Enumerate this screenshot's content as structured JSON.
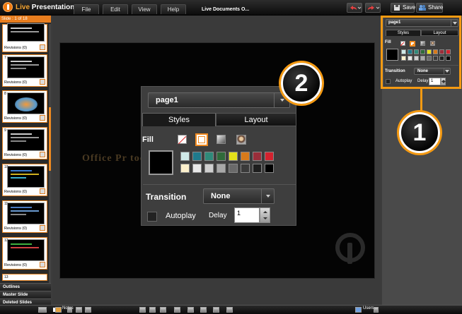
{
  "app": {
    "title_live": "Live",
    "title_rest": "Presentations",
    "document_title": "Live Documents  O..."
  },
  "menu": [
    "File",
    "Edit",
    "View",
    "Help"
  ],
  "toolbar": {
    "save_label": "Save",
    "share_label": "Share"
  },
  "slides_panel": {
    "header": "Slide : 1 of 18",
    "revisions_label": "Revisions (0)",
    "slides": [
      "7",
      "8",
      "9",
      "10",
      "11",
      "12",
      "13"
    ]
  },
  "left_tabs": [
    "Outlines",
    "Master Slide",
    "Deleted Slides"
  ],
  "slide_canvas": {
    "text": "Office Pr                                   today"
  },
  "properties": {
    "shape_name": "page1",
    "tab_styles": "Styles",
    "tab_layout": "Layout",
    "fill_label": "Fill",
    "transition_label": "Transition",
    "transition_value": "None",
    "autoplay_label": "Autoplay",
    "delay_label": "Delay",
    "delay_value": "1"
  },
  "swatches_row1": [
    "#cfe9e8",
    "#1f7a8c",
    "#2f8a7a",
    "#2f6a3a",
    "#e3e01a",
    "#d77a1a",
    "#9a2e3a",
    "#d2222e"
  ],
  "swatches_row2": [
    "#fdf0cc",
    "#e8e8e8",
    "#cfcfcf",
    "#a8a8a8",
    "#6a6a6a",
    "#3a3a3a",
    "#1e1e1e",
    "#000000"
  ],
  "callouts": {
    "small": "1",
    "big": "2"
  },
  "bottom": {
    "notes": "Notes",
    "users": "Users"
  },
  "accent_color": "#f59a12"
}
